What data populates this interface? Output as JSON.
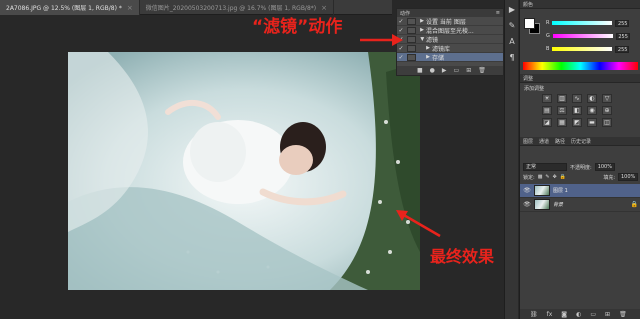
{
  "tabs": [
    {
      "label": "2A7086.JPG @ 12.5% (图层 1, RGB/8) *",
      "close": "×",
      "active": true
    },
    {
      "label": "微信图片_20200503200713.jpg @ 16.7% (图层 1, RGB/8*)",
      "close": "×",
      "active": false
    }
  ],
  "actions_panel": {
    "title": "动作",
    "rows": [
      {
        "check": "✓",
        "label": "设置 当前 图层",
        "selected": false
      },
      {
        "check": "✓",
        "label": "混合图层至光棱...",
        "selected": false
      },
      {
        "check": "✓",
        "label": "滤镜",
        "selected": false
      },
      {
        "check": "✓",
        "label": "滤镜库",
        "selected": false
      },
      {
        "check": "✓",
        "label": "存储",
        "selected": true
      }
    ],
    "footer_icons": [
      "stop-icon",
      "record-icon",
      "play-icon",
      "new-set-icon",
      "new-action-icon",
      "delete-icon"
    ]
  },
  "color_panel": {
    "title": "颜色",
    "channels": [
      {
        "name": "R",
        "value": "255"
      },
      {
        "name": "G",
        "value": "255"
      },
      {
        "name": "B",
        "value": "255"
      }
    ]
  },
  "adjustments_panel": {
    "tab": "调整",
    "title": "添加调整"
  },
  "layers_panel": {
    "tabs": [
      "图层",
      "通道",
      "路径",
      "历史记录"
    ],
    "blend_mode": "正常",
    "opacity_label": "不透明度:",
    "opacity_value": "100%",
    "lock_label": "锁定:",
    "fill_label": "填充:",
    "fill_value": "100%",
    "layers": [
      {
        "name": "图层 1",
        "selected": true
      },
      {
        "name": "背景",
        "selected": false
      }
    ]
  },
  "annotations": {
    "top": "“滤镜”动作",
    "bottom": "最终效果",
    "color": "#e8231c"
  }
}
